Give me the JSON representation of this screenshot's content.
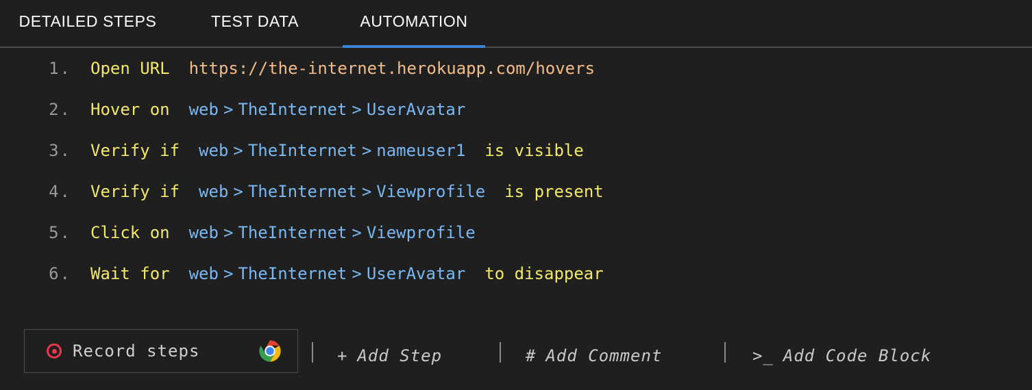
{
  "tabs": [
    {
      "label": "DETAILED STEPS",
      "active": false
    },
    {
      "label": "TEST DATA",
      "active": false
    },
    {
      "label": "AUTOMATION",
      "active": true
    }
  ],
  "steps": [
    {
      "number": "1.",
      "keyword": "Open URL",
      "target_type": "url",
      "url": "https://the-internet.herokuapp.com/hovers",
      "path": [],
      "suffix": ""
    },
    {
      "number": "2.",
      "keyword": "Hover on",
      "target_type": "locator",
      "url": "",
      "path": [
        "web",
        "TheInternet",
        "UserAvatar"
      ],
      "suffix": ""
    },
    {
      "number": "3.",
      "keyword": "Verify if",
      "target_type": "locator",
      "url": "",
      "path": [
        "web",
        "TheInternet",
        "nameuser1"
      ],
      "suffix": "is visible"
    },
    {
      "number": "4.",
      "keyword": "Verify if",
      "target_type": "locator",
      "url": "",
      "path": [
        "web",
        "TheInternet",
        "Viewprofile"
      ],
      "suffix": "is present"
    },
    {
      "number": "5.",
      "keyword": "Click on",
      "target_type": "locator",
      "url": "",
      "path": [
        "web",
        "TheInternet",
        "Viewprofile"
      ],
      "suffix": ""
    },
    {
      "number": "6.",
      "keyword": "Wait for",
      "target_type": "locator",
      "url": "",
      "path": [
        "web",
        "TheInternet",
        "UserAvatar"
      ],
      "suffix": "to disappear"
    }
  ],
  "path_separator": ">",
  "toolbar": {
    "record_label": "Record steps",
    "record_icon": "record-icon",
    "browser_icon": "chrome-icon",
    "actions": [
      {
        "glyph": "+",
        "label": "Add Step"
      },
      {
        "glyph": "#",
        "label": "Add Comment"
      },
      {
        "glyph": ">_",
        "label": "Add Code Block"
      }
    ]
  },
  "colors": {
    "background": "#1f1f1f",
    "keyword": "#f2e96b",
    "locator": "#79b8f3",
    "url": "#f3bd8a",
    "step_number": "#9a9a9a",
    "tab_active_underline": "#3d85d8",
    "record_red": "#e8384f",
    "divider": "#4a4a4a"
  }
}
